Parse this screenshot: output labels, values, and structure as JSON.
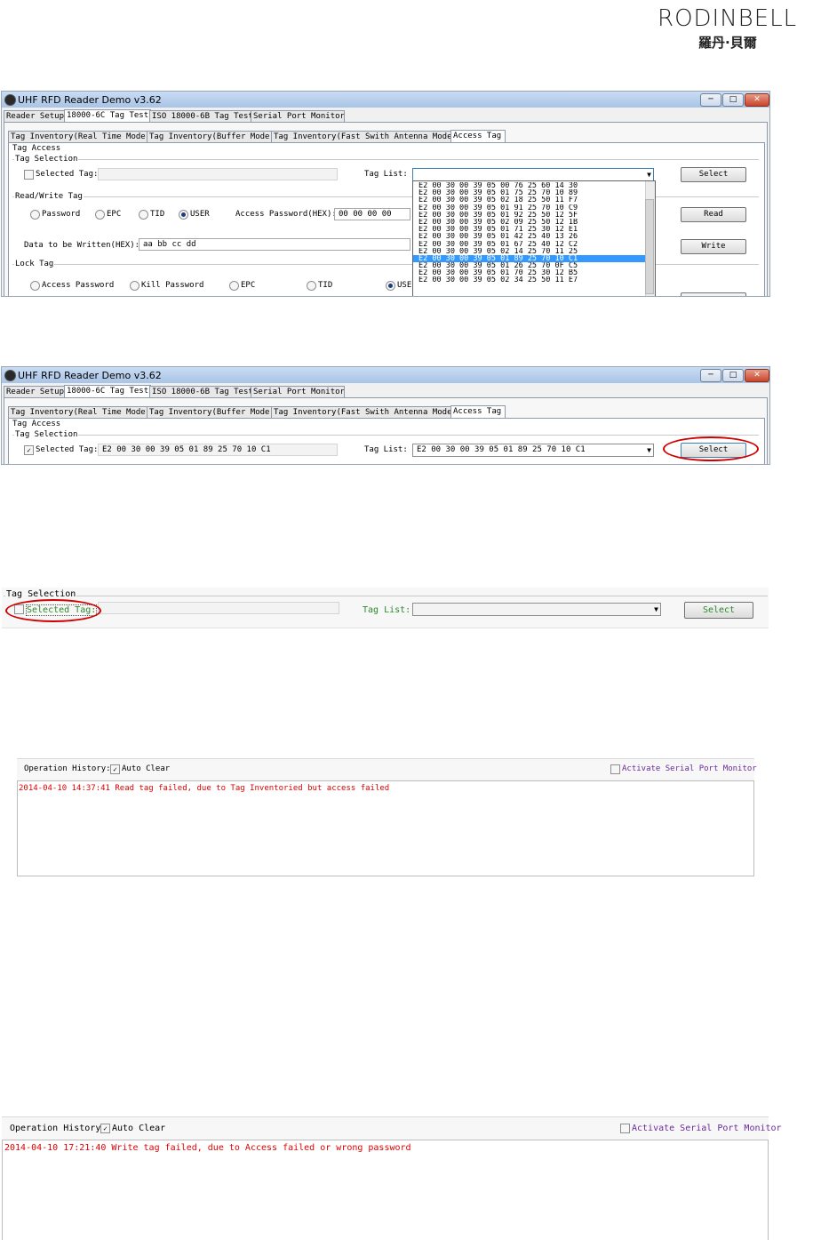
{
  "logo": {
    "wordmark": "RODINBELL",
    "chinese": "羅丹·貝爾"
  },
  "window": {
    "title": "UHF RFD Reader Demo v3.62",
    "min": "─",
    "max": "□",
    "close": "✕",
    "tabs": [
      "Reader Setup",
      "18000-6C Tag Test",
      "ISO 18000-6B Tag Test",
      "Serial Port Monitor"
    ],
    "subtabs": [
      "Tag Inventory(Real Time Mode)",
      "Tag Inventory(Buffer Mode)",
      "Tag Inventory(Fast Swith Antenna Mode)",
      "Access Tag"
    ]
  },
  "shot1": {
    "access_group": "Tag Access",
    "selection_group": "Tag Selection",
    "selected_tag_label": "Selected Tag:",
    "tag_list_label": "Tag List:",
    "select_btn": "Select",
    "rw_group": "Read/Write Tag",
    "radios": [
      "Password",
      "EPC",
      "TID",
      "USER"
    ],
    "access_pwd_label": "Access Password(HEX):",
    "access_pwd_value": "00 00 00 00",
    "read_btn": "Read",
    "data_label": "Data to be Written(HEX):",
    "data_value": "aa bb cc dd",
    "write_btn": "Write",
    "lock_group": "Lock Tag",
    "lock_radios": [
      "Access Password",
      "Kill Password",
      "EPC",
      "TID",
      "USER"
    ],
    "dropdown_items": [
      "E2 00 30 00 39 05 00 76 25 60 14 30",
      "E2 00 30 00 39 05 01 75 25 70 10 89",
      "E2 00 30 00 39 05 02 18 25 50 11 F7",
      "E2 00 30 00 39 05 01 91 25 70 10 C9",
      "E2 00 30 00 39 05 01 92 25 50 12 5F",
      "E2 00 30 00 39 05 02 09 25 50 12 1B",
      "E2 00 30 00 39 05 01 71 25 30 12 E1",
      "E2 00 30 00 39 05 01 42 25 40 13 26",
      "E2 00 30 00 39 05 01 67 25 40 12 C2",
      "E2 00 30 00 39 05 02 14 25 70 11 25",
      "E2 00 30 00 39 05 01 89 25 70 10 C1",
      "E2 00 30 00 39 05 01 26 25 70 0F C5",
      "E2 00 30 00 39 05 01 70 25 30 12 B5",
      "E2 00 30 00 39 05 02 34 25 50 11 E7"
    ],
    "selected_index": 10
  },
  "shot2": {
    "access_group": "Tag Access",
    "selection_group": "Tag Selection",
    "selected_tag_label": "Selected Tag:",
    "selected_tag_value": "E2 00 30 00 39 05 01 89 25 70 10 C1",
    "tag_list_label": "Tag List:",
    "tag_list_value": "E2 00 30 00 39 05 01 89 25 70 10 C1",
    "select_btn": "Select"
  },
  "shot3": {
    "selection_group": "Tag Selection",
    "selected_tag_label": "Selected Tag:",
    "tag_list_label": "Tag List:",
    "select_btn": "Select"
  },
  "shot4": {
    "history_label": "Operation History:",
    "auto_clear": "Auto Clear",
    "serial_monitor": "Activate Serial Port Monitor",
    "log": "2014-04-10 14:37:41 Read tag failed, due to Tag Inventoried but access failed"
  },
  "shot5": {
    "history_label": "Operation History:",
    "auto_clear": "Auto Clear",
    "serial_monitor": "Activate Serial Port Monitor",
    "log": "2014-04-10 17:21:40 Write tag failed, due to Access failed or wrong password"
  },
  "colors": {
    "error": "#e00000",
    "oval": "#d00000",
    "highlight": "#3399ff",
    "link": "#6a2a9a"
  }
}
